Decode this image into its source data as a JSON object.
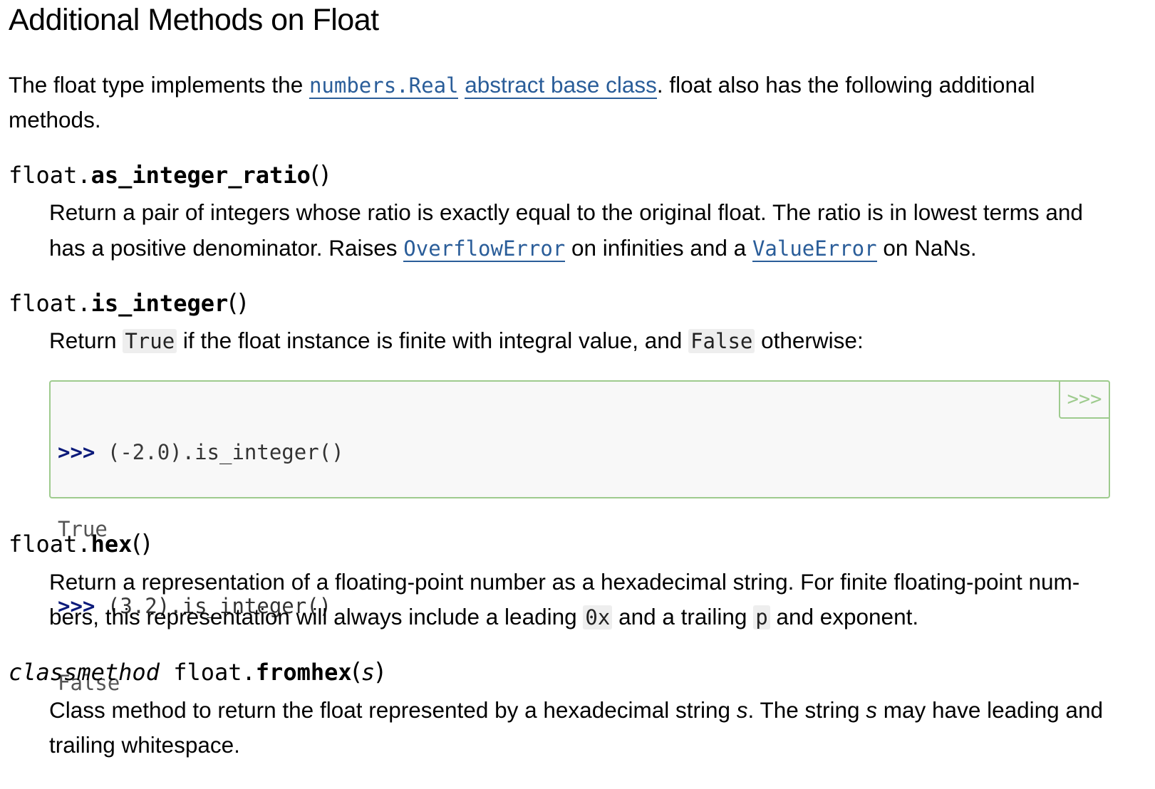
{
  "heading": "Additional Methods on Float",
  "intro": {
    "text_before": "The float type implements the ",
    "link_numbers_real": "numbers.Real",
    "space": " ",
    "link_abc": "abstract base class",
    "text_after": ". float also has the following additional",
    "line2": "methods."
  },
  "methods": {
    "as_integer_ratio": {
      "prefix": "float.",
      "name": "as_integer_ratio",
      "params": "()",
      "desc_line1": "Return a pair of integers whose ratio is exactly equal to the original float. The ratio is in lowest terms and",
      "desc_line2_a": "has a positive denominator. Raises ",
      "link_overflow": "OverflowError",
      "desc_line2_b": " on infinities and a ",
      "link_value": "ValueError",
      "desc_line2_c": " on NaNs."
    },
    "is_integer": {
      "prefix": "float.",
      "name": "is_integer",
      "params": "()",
      "desc_a": "Return ",
      "code_true": "True",
      "desc_b": " if the float instance is finite with integral value, and ",
      "code_false": "False",
      "desc_c": " otherwise:",
      "example": {
        "copy_label": ">>>",
        "lines": [
          {
            "prompt": ">>> ",
            "open": "(",
            "num": "-2.0",
            "rest": ").is_integer()"
          },
          {
            "output": "True"
          },
          {
            "prompt": ">>> ",
            "open": "(",
            "num": "3.2",
            "rest": ").is_integer()"
          },
          {
            "output": "False"
          }
        ]
      }
    },
    "hex": {
      "prefix": "float.",
      "name": "hex",
      "params": "()",
      "desc_line1": "Return a representation of a floating-point number as a hexadecimal string. For finite floating-point num-",
      "desc_line2_a": "bers, this representation will always include a leading ",
      "code_0x": "0x",
      "desc_line2_b": " and a trailing ",
      "code_p": "p",
      "desc_line2_c": " and exponent."
    },
    "fromhex": {
      "keyword": "classmethod",
      "space": " ",
      "prefix": "float.",
      "name": "fromhex",
      "paren_open": "(",
      "param": "s",
      "paren_close": ")",
      "desc_line1_a": "Class method to return the float represented by a hexadecimal string ",
      "var_s1": "s",
      "desc_line1_b": ". The string ",
      "var_s2": "s",
      "desc_line1_c": " may have leading and",
      "desc_line2": "trailing whitespace."
    }
  },
  "colors": {
    "link": "#2a5d99",
    "code_border": "#9ecb8e",
    "prompt": "#0b1a7a"
  }
}
